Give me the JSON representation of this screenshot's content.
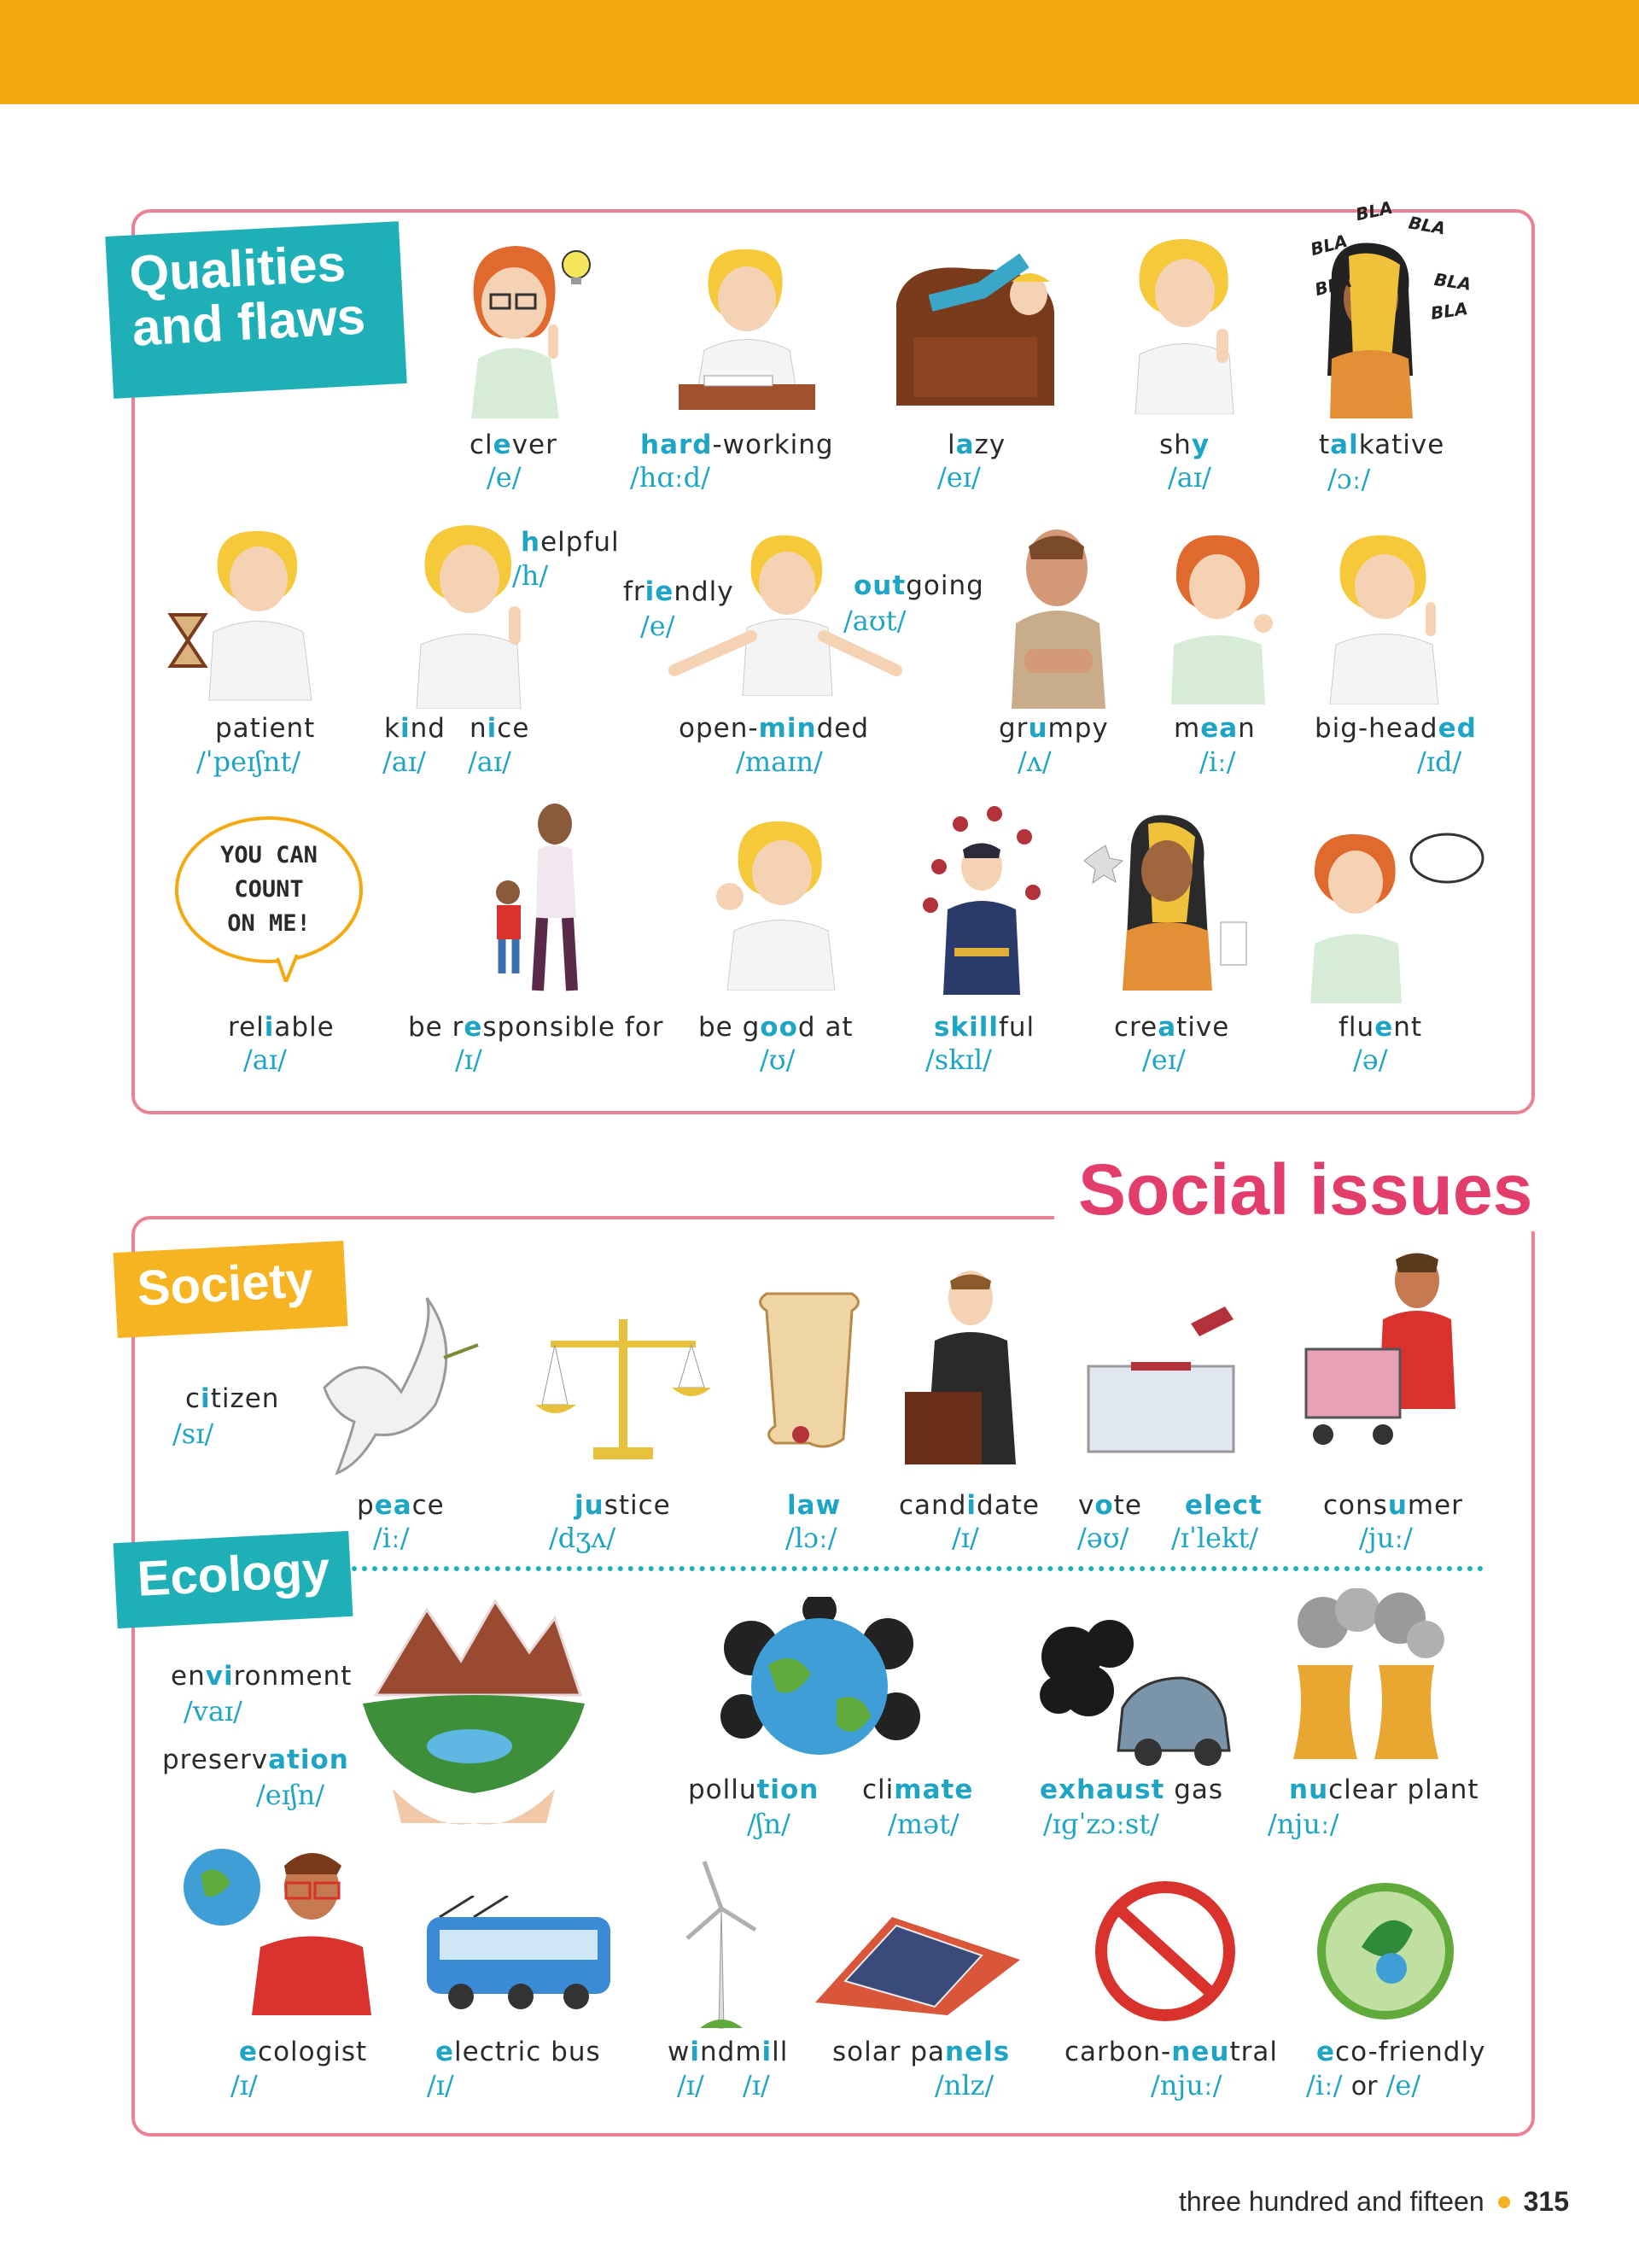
{
  "qualities": {
    "tag": [
      "Qualities",
      "and flaws"
    ],
    "words": [
      {
        "pre": "cl",
        "hl": "e",
        "post": "ver",
        "ipa": "/e/"
      },
      {
        "pre": "",
        "hl": "hard",
        "post": "-working",
        "ipa": "/hɑːd/"
      },
      {
        "pre": "l",
        "hl": "a",
        "post": "zy",
        "ipa": "/eɪ/"
      },
      {
        "pre": "sh",
        "hl": "y",
        "post": "",
        "ipa": "/aɪ/"
      },
      {
        "pre": "t",
        "hl": "al",
        "post": "kative",
        "ipa": "/ɔː/"
      },
      {
        "pre": "",
        "hl": "h",
        "post": "elpful",
        "ipa": "/h/"
      },
      {
        "pre": "fr",
        "hl": "ie",
        "post": "ndly",
        "ipa": "/e/"
      },
      {
        "pre": "",
        "hl": "out",
        "post": "going",
        "ipa": "/aʊt/"
      },
      {
        "pre": "patient",
        "hl": "",
        "post": "",
        "ipa": "/ˈpeɪʃnt/"
      },
      {
        "pre": "k",
        "hl": "i",
        "post": "nd",
        "ipa": "/aɪ/"
      },
      {
        "pre": "n",
        "hl": "i",
        "post": "ce",
        "ipa": "/aɪ/"
      },
      {
        "pre": "open-",
        "hl": "min",
        "post": "ded",
        "ipa": "/maɪn/"
      },
      {
        "pre": "gr",
        "hl": "u",
        "post": "mpy",
        "ipa": "/ʌ/"
      },
      {
        "pre": "m",
        "hl": "ea",
        "post": "n",
        "ipa": "/iː/"
      },
      {
        "pre": "big-head",
        "hl": "ed",
        "post": "",
        "ipa": "/ɪd/"
      },
      {
        "pre": "rel",
        "hl": "i",
        "post": "able",
        "ipa": "/aɪ/"
      },
      {
        "pre": "be r",
        "hl": "e",
        "post": "sponsible for",
        "ipa": "/ɪ/"
      },
      {
        "pre": "be g",
        "hl": "oo",
        "post": "d at",
        "ipa": "/ʊ/"
      },
      {
        "pre": "",
        "hl": "skill",
        "post": "ful",
        "ipa": "/skɪl/"
      },
      {
        "pre": "cre",
        "hl": "a",
        "post": "tive",
        "ipa": "/eɪ/"
      },
      {
        "pre": "flu",
        "hl": "e",
        "post": "nt",
        "ipa": "/ə/"
      }
    ],
    "bubble": [
      "YOU CAN",
      "COUNT",
      "ON ME!"
    ],
    "bla": "BLA"
  },
  "social": {
    "title": "Social issues",
    "society_tag": "Society",
    "ecology_tag": "Ecology",
    "words": [
      {
        "pre": "c",
        "hl": "i",
        "post": "tizen",
        "ipa": "/sɪ/"
      },
      {
        "pre": "p",
        "hl": "ea",
        "post": "ce",
        "ipa": "/iː/"
      },
      {
        "pre": "",
        "hl": "ju",
        "post": "stice",
        "ipa": "/dʒʌ/"
      },
      {
        "pre": "",
        "hl": "law",
        "post": "",
        "ipa": "/lɔː/"
      },
      {
        "pre": "cand",
        "hl": "i",
        "post": "date",
        "ipa": "/ɪ/"
      },
      {
        "pre": "v",
        "hl": "o",
        "post": "te",
        "ipa": "/əʊ/"
      },
      {
        "pre": "",
        "hl": "elect",
        "post": "",
        "ipa": "/ɪˈlekt/"
      },
      {
        "pre": "cons",
        "hl": "u",
        "post": "mer",
        "ipa": "/juː/"
      },
      {
        "pre": "en",
        "hl": "vi",
        "post": "ronment",
        "ipa": "/vaɪ/"
      },
      {
        "pre": "preserv",
        "hl": "ation",
        "post": "",
        "ipa": "/eɪʃn/"
      },
      {
        "pre": "pollu",
        "hl": "tion",
        "post": "",
        "ipa": "/ʃn/"
      },
      {
        "pre": "cli",
        "hl": "mate",
        "post": "",
        "ipa": "/mət/"
      },
      {
        "pre": "",
        "hl": "exhaust",
        "post": " gas",
        "ipa": "/ɪɡˈzɔːst/"
      },
      {
        "pre": "",
        "hl": "nu",
        "post": "clear plant",
        "ipa": "/njuː/"
      },
      {
        "pre": "",
        "hl": "e",
        "post": "cologist",
        "ipa": "/ɪ/"
      },
      {
        "pre": "",
        "hl": "e",
        "post": "lectric bus",
        "ipa": "/ɪ/"
      },
      {
        "pre": "w",
        "hl": "i",
        "post": "ndm",
        "hl2": "i",
        "post2": "ll",
        "ipa": "/ɪ/",
        "ipa2": "/ɪ/"
      },
      {
        "pre": "solar pa",
        "hl": "nels",
        "post": "",
        "ipa": "/nlz/"
      },
      {
        "pre": "carbon-",
        "hl": "neu",
        "post": "tral",
        "ipa": "/njuː/"
      },
      {
        "pre": "",
        "hl": "e",
        "post": "co-friendly",
        "ipa": "/iː/",
        "or": "or",
        "ipa2": "/e/"
      }
    ]
  },
  "footer": {
    "text": "three hundred and fifteen",
    "page": "315"
  },
  "colors": {
    "accent_orange": "#f5a80f",
    "teal": "#1fb0b7",
    "pink": "#e23d6b",
    "panel_border": "#ea8293",
    "ipa_blue": "#1ea4c4"
  }
}
